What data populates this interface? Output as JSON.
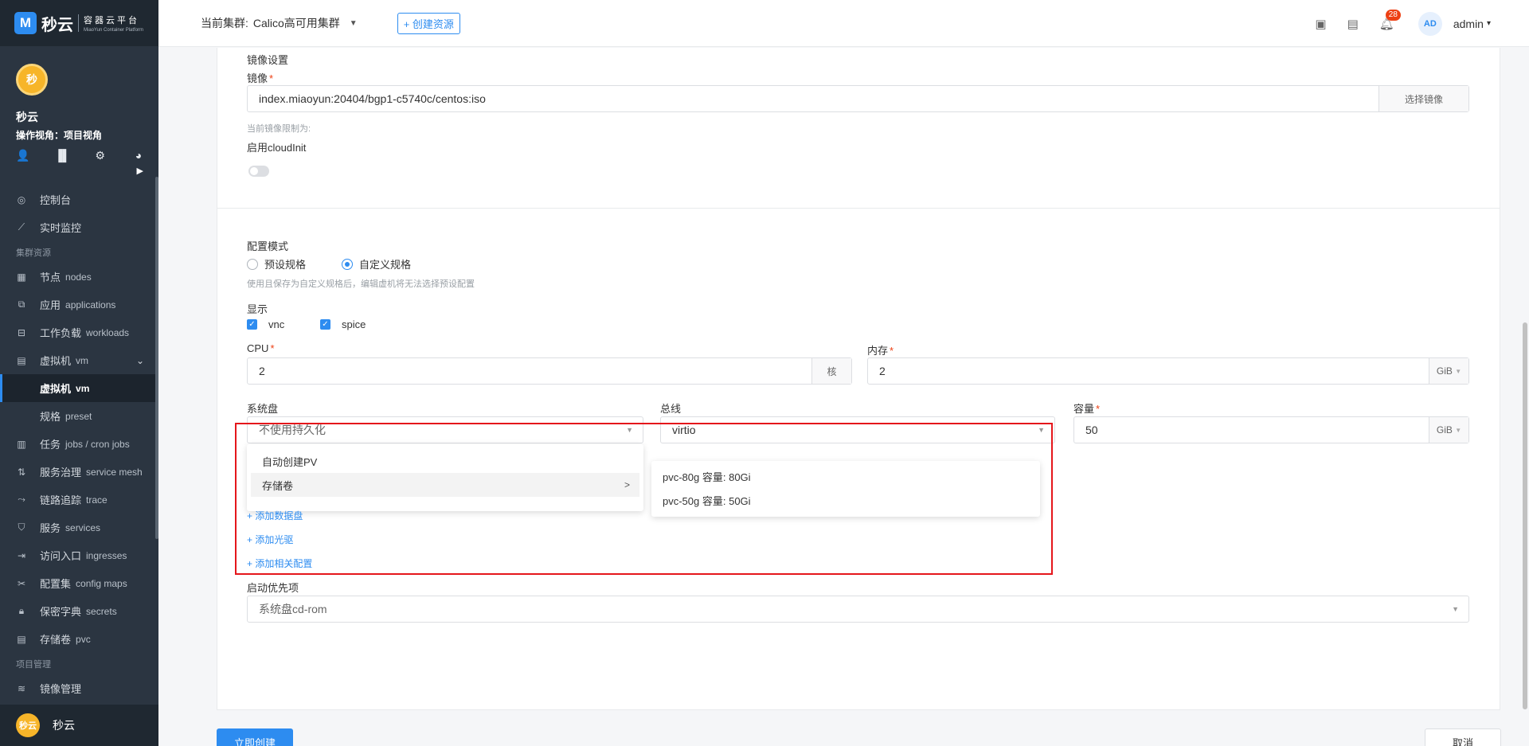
{
  "brand": {
    "logo_char": "M",
    "name": "秒云",
    "sub_cn": "容器云平台",
    "sub_en": "MiaoYun Container Platform"
  },
  "project": {
    "avatar_text": "秒",
    "name": "秒云",
    "view_label": "操作视角：项目视角"
  },
  "nav": {
    "console": "控制台",
    "monitor": "实时监控",
    "group_cluster": "集群资源",
    "nodes_cn": "节点",
    "nodes_en": "nodes",
    "apps_cn": "应用",
    "apps_en": "applications",
    "workloads_cn": "工作负载",
    "workloads_en": "workloads",
    "vm_cn": "虚拟机",
    "vm_en": "vm",
    "vm_sub_cn": "虚拟机",
    "vm_sub_en": "vm",
    "preset_cn": "规格",
    "preset_en": "preset",
    "jobs_cn": "任务",
    "jobs_en": "jobs / cron jobs",
    "mesh_cn": "服务治理",
    "mesh_en": "service mesh",
    "trace_cn": "链路追踪",
    "trace_en": "trace",
    "services_cn": "服务",
    "services_en": "services",
    "ingress_cn": "访问入口",
    "ingress_en": "ingresses",
    "configmap_cn": "配置集",
    "configmap_en": "config maps",
    "secrets_cn": "保密字典",
    "secrets_en": "secrets",
    "pvc_cn": "存储卷",
    "pvc_en": "pvc",
    "group_project": "项目管理",
    "images": "镜像管理"
  },
  "footer": {
    "avatar_text": "秒云",
    "name": "秒云"
  },
  "header": {
    "cluster_label": "当前集群:",
    "cluster_value": "Calico高可用集群",
    "create_btn": "+ 创建资源",
    "notif_count": "28",
    "user_initials": "AD",
    "user_name": "admin"
  },
  "image_section": {
    "title": "镜像设置",
    "image_label": "镜像",
    "image_value": "index.miaoyun:20404/bgp1-c5740c/centos:iso",
    "choose_btn": "选择镜像",
    "limit_hint": "当前镜像限制为:",
    "cloudinit_label": "启用cloudInit",
    "cloudinit_enabled": false
  },
  "config": {
    "mode_label": "配置模式",
    "mode_preset": "预设规格",
    "mode_custom": "自定义规格",
    "mode_selected": "custom",
    "mode_hint": "使用且保存为自定义规格后，编辑虚机将无法选择预设配置",
    "display_label": "显示",
    "display_vnc": "vnc",
    "display_spice": "spice",
    "cpu_label": "CPU",
    "cpu_value": "2",
    "cpu_unit": "核",
    "mem_label": "内存",
    "mem_value": "2",
    "mem_unit": "GiB",
    "sysdisk_label": "系统盘",
    "sysdisk_placeholder": "不使用持久化",
    "bus_label": "总线",
    "bus_value": "virtio",
    "capacity_label": "容量",
    "capacity_value": "50",
    "capacity_unit": "GiB",
    "dd_auto_pv": "自动创建PV",
    "dd_volume": "存储卷",
    "dd_volume_arrow": ">",
    "pvc_options": [
      "pvc-80g 容量: 80Gi",
      "pvc-50g 容量: 50Gi"
    ],
    "add_disk": "+ 添加数据盘",
    "add_cdrom": "+ 添加光驱",
    "add_related": "+ 添加相关配置",
    "boot_label": "启动优先项",
    "boot_value": "系统盘cd-rom"
  },
  "actions": {
    "create": "立即创建",
    "cancel": "取消"
  },
  "colors": {
    "primary": "#2d8cf0",
    "sidebar": "#2b3541",
    "highlight": "#e5161b"
  }
}
